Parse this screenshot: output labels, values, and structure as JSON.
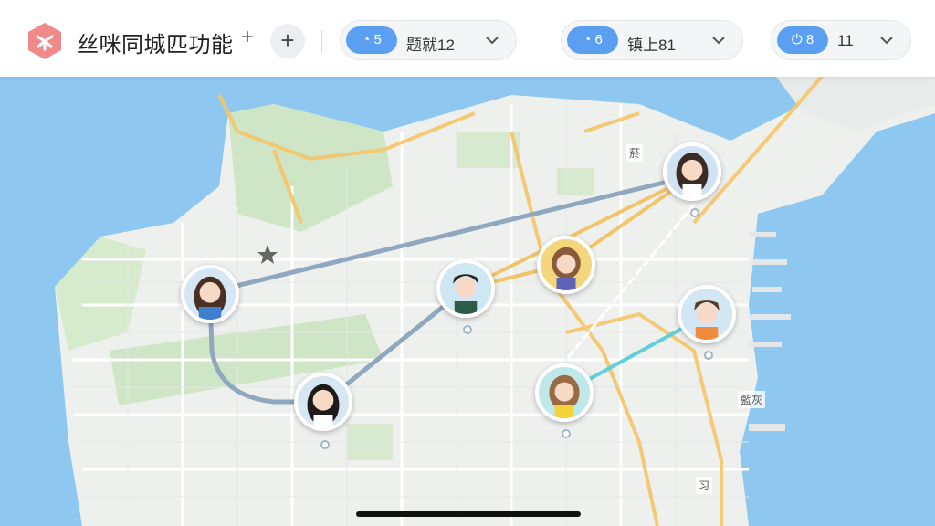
{
  "app": {
    "title": "丝咪同城匹功能",
    "add_small": "+",
    "add_button": "+"
  },
  "filters": [
    {
      "pill": "5",
      "label": "题就12"
    },
    {
      "pill": "6",
      "label": "镇上81"
    },
    {
      "pill": "8",
      "label": "11"
    }
  ],
  "map_labels": {
    "label_top_right": "菸",
    "label_right": "藍灰",
    "label_bottom": "习"
  },
  "colors": {
    "accent": "#5b9ff2",
    "water": "#8ec8f0",
    "land": "#f1f3f2",
    "park": "#cfe6c6",
    "road": "#f6c467"
  }
}
